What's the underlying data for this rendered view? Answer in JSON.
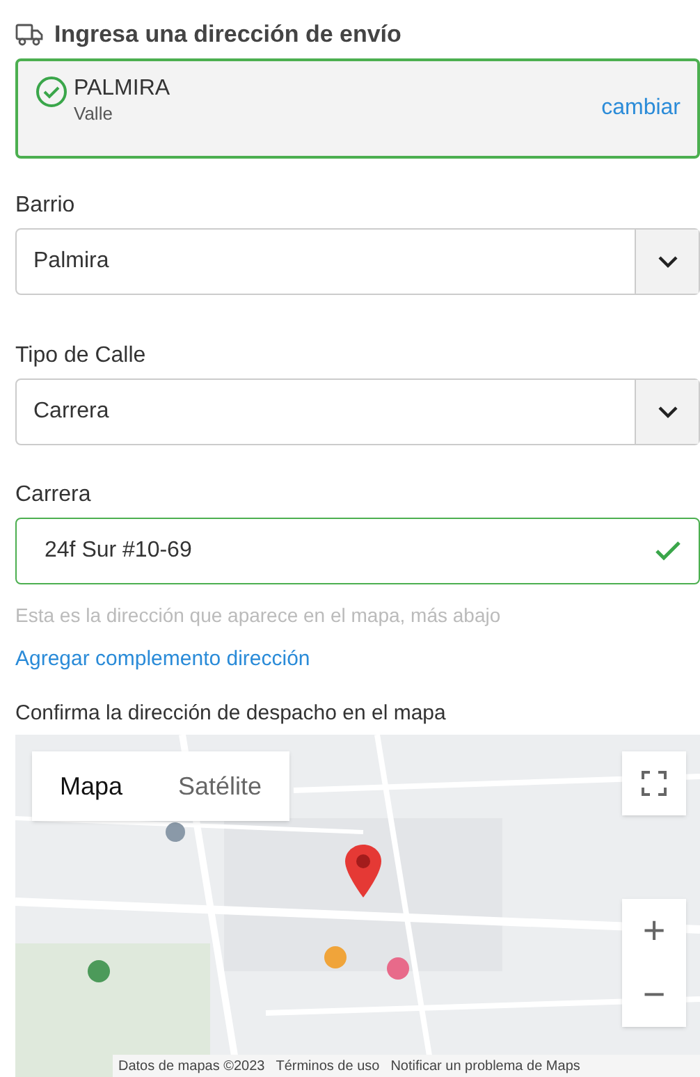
{
  "title": "Ingresa una dirección de envío",
  "city": {
    "name": "PALMIRA",
    "region": "Valle",
    "verified": true,
    "action": "cambiar"
  },
  "fields": [
    {
      "kind": "select",
      "label": "Barrio",
      "value": "Palmira"
    },
    {
      "kind": "select",
      "label": "Tipo de Calle",
      "value": "Carrera"
    },
    {
      "kind": "text",
      "label": "Carrera",
      "value": "24f Sur #10-69",
      "valid": true
    }
  ],
  "hint": "Esta es la dirección que aparece en el mapa, más abajo",
  "link": "Agregar complemento dirección",
  "map": {
    "heading": "Confirma la dirección de despacho en el mapa",
    "map_types": [
      {
        "label": "Mapa",
        "selected": true
      },
      {
        "label": "Satélite",
        "selected": false
      }
    ],
    "zoom": [
      "+",
      "−"
    ],
    "footer": [
      "Datos de mapas ©2023",
      "Términos de uso",
      "Notificar un problema de Maps"
    ]
  }
}
